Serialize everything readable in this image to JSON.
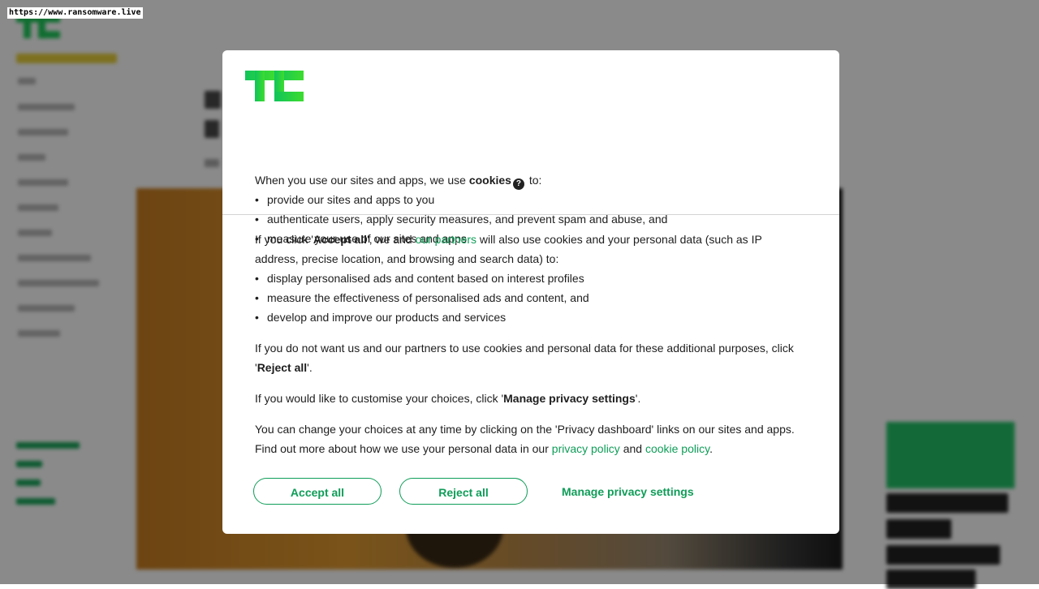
{
  "browser": {
    "url": "https://www.ransomware.live"
  },
  "colors": {
    "accent": "#0f9d58",
    "logo": "#1fcb5b",
    "overlay": "rgba(0,0,0,0.46)"
  },
  "dialog": {
    "intro": {
      "before": "When you use our sites and apps, we use ",
      "cookies": "cookies",
      "help_icon": "?",
      "after": " to:",
      "items": [
        "provide our sites and apps to you",
        "authenticate users, apply security measures, and prevent spam and abuse, and",
        "measure your use of our sites and apps"
      ]
    },
    "partners": {
      "p1": "If you click '",
      "accept_all": "Accept all",
      "p2": "', we and ",
      "link": "our partners",
      "p3": " will also use cookies and your personal data (such as IP address, precise location, and browsing and search data) to:",
      "items": [
        "display personalised ads and content based on interest profiles",
        "measure the effectiveness of personalised ads and content, and",
        "develop and improve our products and services"
      ]
    },
    "reject_para": {
      "p1": "If you do not want us and our partners to use cookies and personal data for these additional purposes, click '",
      "bold": "Reject all",
      "p2": "'."
    },
    "manage_para": {
      "p1": "If you would like to customise your choices, click '",
      "bold": "Manage privacy settings",
      "p2": "'."
    },
    "change_para": {
      "p1": "You can change your choices at any time by clicking on the 'Privacy dashboard' links on our sites and apps. Find out more about how we use your personal data in our ",
      "privacy_link": "privacy policy",
      "p2": " and ",
      "cookie_link": "cookie policy",
      "p3": "."
    },
    "buttons": {
      "accept": "Accept all",
      "reject": "Reject all",
      "manage": "Manage privacy settings"
    }
  }
}
